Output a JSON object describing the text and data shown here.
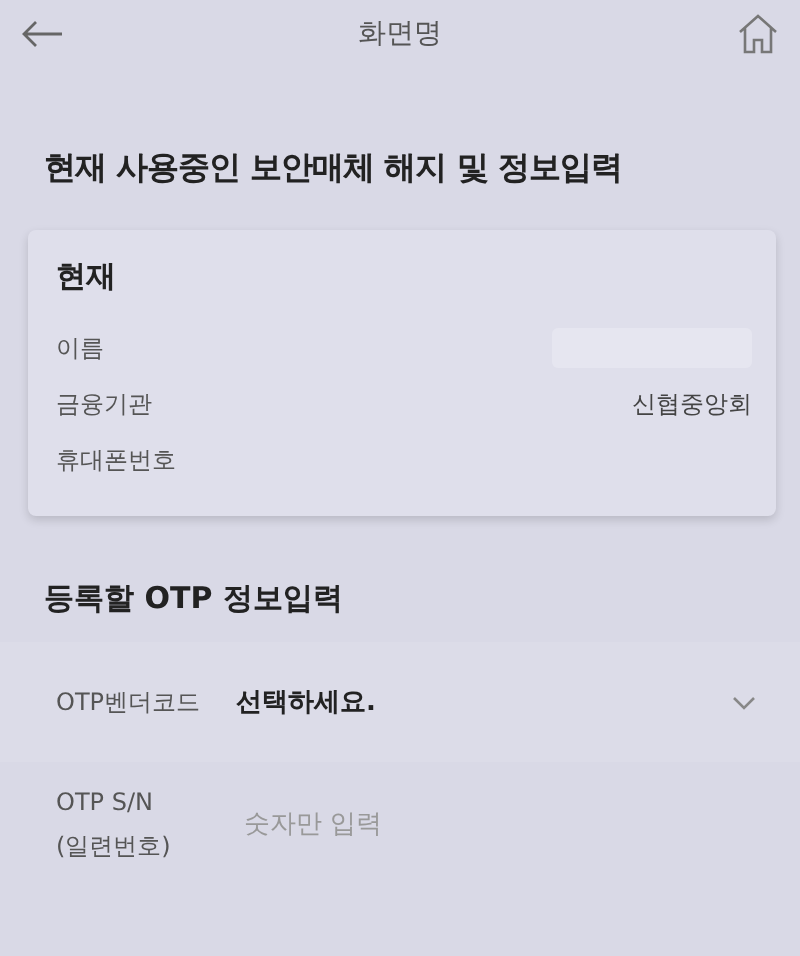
{
  "header": {
    "title": "화면명"
  },
  "heading": "현재 사용중인 보안매체 해지 및 정보입력",
  "current": {
    "title": "현재",
    "rows": [
      {
        "label": "이름",
        "masked": true
      },
      {
        "label": "금융기관",
        "masked": false,
        "value": "신협중앙회"
      },
      {
        "label": "휴대폰번호",
        "masked": false
      }
    ]
  },
  "otp": {
    "title": "등록할 OTP 정보입력",
    "fields": [
      {
        "kind": "select",
        "label": "OTP벤더코드",
        "value": "선택하세요."
      },
      {
        "kind": "input",
        "label": "OTP S/N\n(일련번호)",
        "placeholder": "숫자만 입력"
      }
    ]
  }
}
